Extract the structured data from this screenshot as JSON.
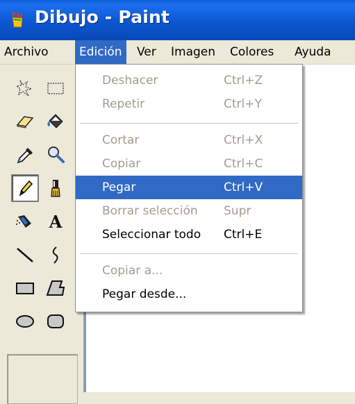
{
  "window": {
    "title": "Dibujo - Paint"
  },
  "menubar": {
    "items": [
      {
        "label": "Archivo"
      },
      {
        "label": "Edición"
      },
      {
        "label": "Ver"
      },
      {
        "label": "Imagen"
      },
      {
        "label": "Colores"
      },
      {
        "label": "Ayuda"
      }
    ]
  },
  "edit_menu": {
    "items": [
      {
        "label": "Deshacer",
        "shortcut": "Ctrl+Z",
        "enabled": false
      },
      {
        "label": "Repetir",
        "shortcut": "Ctrl+Y",
        "enabled": false
      },
      {
        "label": "Cortar",
        "shortcut": "Ctrl+X",
        "enabled": false
      },
      {
        "label": "Copiar",
        "shortcut": "Ctrl+C",
        "enabled": false
      },
      {
        "label": "Pegar",
        "shortcut": "Ctrl+V",
        "enabled": true,
        "highlighted": true
      },
      {
        "label": "Borrar selección",
        "shortcut": "Supr",
        "enabled": false
      },
      {
        "label": "Seleccionar todo",
        "shortcut": "Ctrl+E",
        "enabled": true
      },
      {
        "label": "Copiar a...",
        "shortcut": "",
        "enabled": false
      },
      {
        "label": "Pegar desde...",
        "shortcut": "",
        "enabled": true
      }
    ]
  },
  "toolbox": {
    "tools": [
      {
        "icon": "free-form-select-icon"
      },
      {
        "icon": "rect-select-icon"
      },
      {
        "icon": "eraser-icon"
      },
      {
        "icon": "fill-bucket-icon"
      },
      {
        "icon": "color-picker-icon"
      },
      {
        "icon": "magnifier-icon"
      },
      {
        "icon": "pencil-icon",
        "selected": true
      },
      {
        "icon": "brush-icon"
      },
      {
        "icon": "airbrush-icon"
      },
      {
        "icon": "text-icon",
        "glyph": "A"
      },
      {
        "icon": "line-icon"
      },
      {
        "icon": "curve-icon"
      },
      {
        "icon": "rectangle-icon"
      },
      {
        "icon": "polygon-icon"
      },
      {
        "icon": "ellipse-icon"
      },
      {
        "icon": "rounded-rectangle-icon"
      }
    ]
  },
  "colors": {
    "titlebar": "#0b57d0",
    "highlight": "#316ac5",
    "disabled_text": "#a19c8f",
    "face": "#ece9d8"
  }
}
